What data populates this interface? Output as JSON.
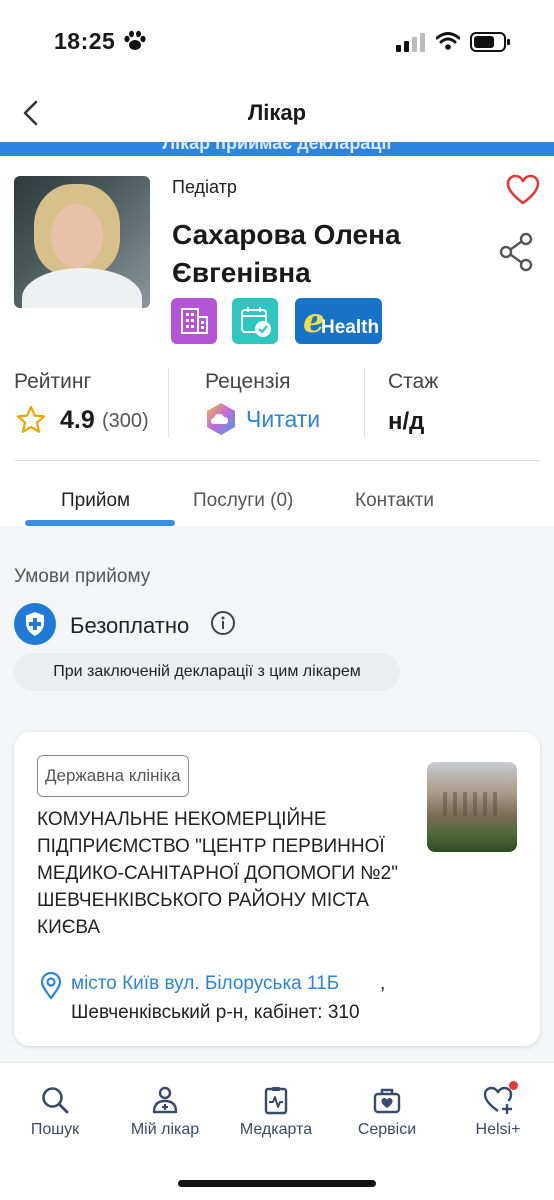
{
  "status_bar": {
    "time": "18:25"
  },
  "nav": {
    "title": "Лікар"
  },
  "banner": {
    "text": "Лікар приймає декларації"
  },
  "doctor": {
    "specialty": "Педіатр",
    "name": "Сахарова Олена Євгенівна"
  },
  "badges": {
    "ehealth_e": "e",
    "ehealth_text": "Health"
  },
  "stats": {
    "rating_label": "Рейтинг",
    "rating_value": "4.9",
    "rating_count": "(300)",
    "review_label": "Рецензія",
    "review_link": "Читати",
    "experience_label": "Стаж",
    "experience_value": "н/д"
  },
  "tabs": [
    {
      "label": "Прийом",
      "active": true
    },
    {
      "label": "Послуги (0)",
      "active": false
    },
    {
      "label": "Контакти",
      "active": false
    }
  ],
  "conditions": {
    "title": "Умови прийому",
    "price": "Безоплатно",
    "note": "При заключеній декларації з цим лікарем"
  },
  "clinic": {
    "type": "Державна клініка",
    "name": "КОМУНАЛЬНЕ НЕКОМЕРЦІЙНЕ ПІДПРИЄМСТВО \"ЦЕНТР ПЕРВИННОЇ МЕДИКО-САНІТАРНОЇ ДОПОМОГИ №2\" ШЕВЧЕНКІВСЬКОГО РАЙОНУ МІСТА КИЄВА",
    "address_link": "місто Київ вул. Білоруська 11Б",
    "address_comma": ",",
    "address_rest": "Шевченківський р-н, кабінет: 310"
  },
  "bottom_nav": [
    {
      "label": "Пошук",
      "icon": "search-icon"
    },
    {
      "label": "Мій лікар",
      "icon": "doctor-icon"
    },
    {
      "label": "Медкарта",
      "icon": "medical-card-icon"
    },
    {
      "label": "Сервіси",
      "icon": "services-icon"
    },
    {
      "label": "Helsi+",
      "icon": "heart-plus-icon"
    }
  ],
  "colors": {
    "accent": "#2a84e0",
    "favorite": "#e53935",
    "badge_clinic": "#b554d6",
    "badge_calendar": "#2cc8c0",
    "badge_ehealth": "#1773c8"
  }
}
